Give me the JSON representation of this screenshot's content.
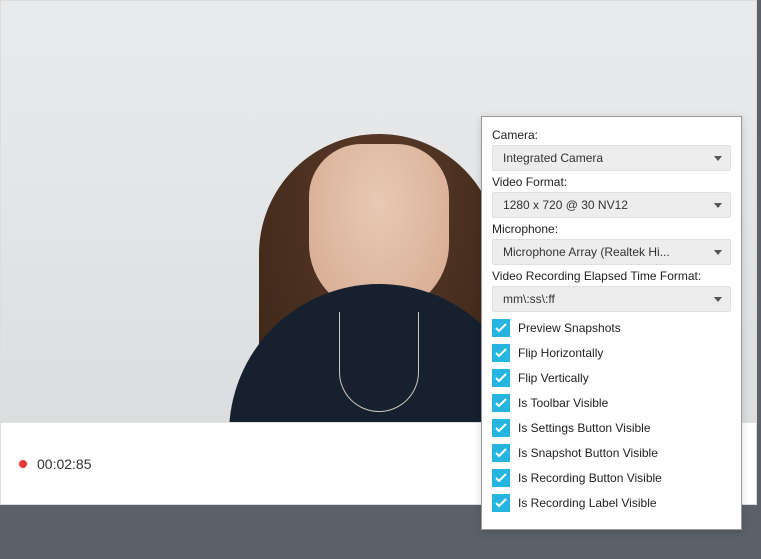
{
  "recording": {
    "elapsed": "00:02:85"
  },
  "settings": {
    "camera": {
      "label": "Camera:",
      "value": "Integrated Camera"
    },
    "videoFormat": {
      "label": "Video Format:",
      "value": "1280 x 720 @ 30 NV12"
    },
    "microphone": {
      "label": "Microphone:",
      "value": "Microphone Array (Realtek Hi..."
    },
    "timeFormat": {
      "label": "Video Recording Elapsed Time Format:",
      "value": "mm\\:ss\\:ff"
    },
    "checkboxes": [
      {
        "label": "Preview Snapshots",
        "checked": true
      },
      {
        "label": "Flip Horizontally",
        "checked": true
      },
      {
        "label": "Flip Vertically",
        "checked": true
      },
      {
        "label": "Is Toolbar Visible",
        "checked": true
      },
      {
        "label": "Is Settings Button Visible",
        "checked": true
      },
      {
        "label": "Is Snapshot Button Visible",
        "checked": true
      },
      {
        "label": "Is Recording Button Visible",
        "checked": true
      },
      {
        "label": "Is Recording Label Visible",
        "checked": true
      }
    ]
  },
  "colors": {
    "accent": "#26b5e0",
    "record": "#e53935"
  }
}
